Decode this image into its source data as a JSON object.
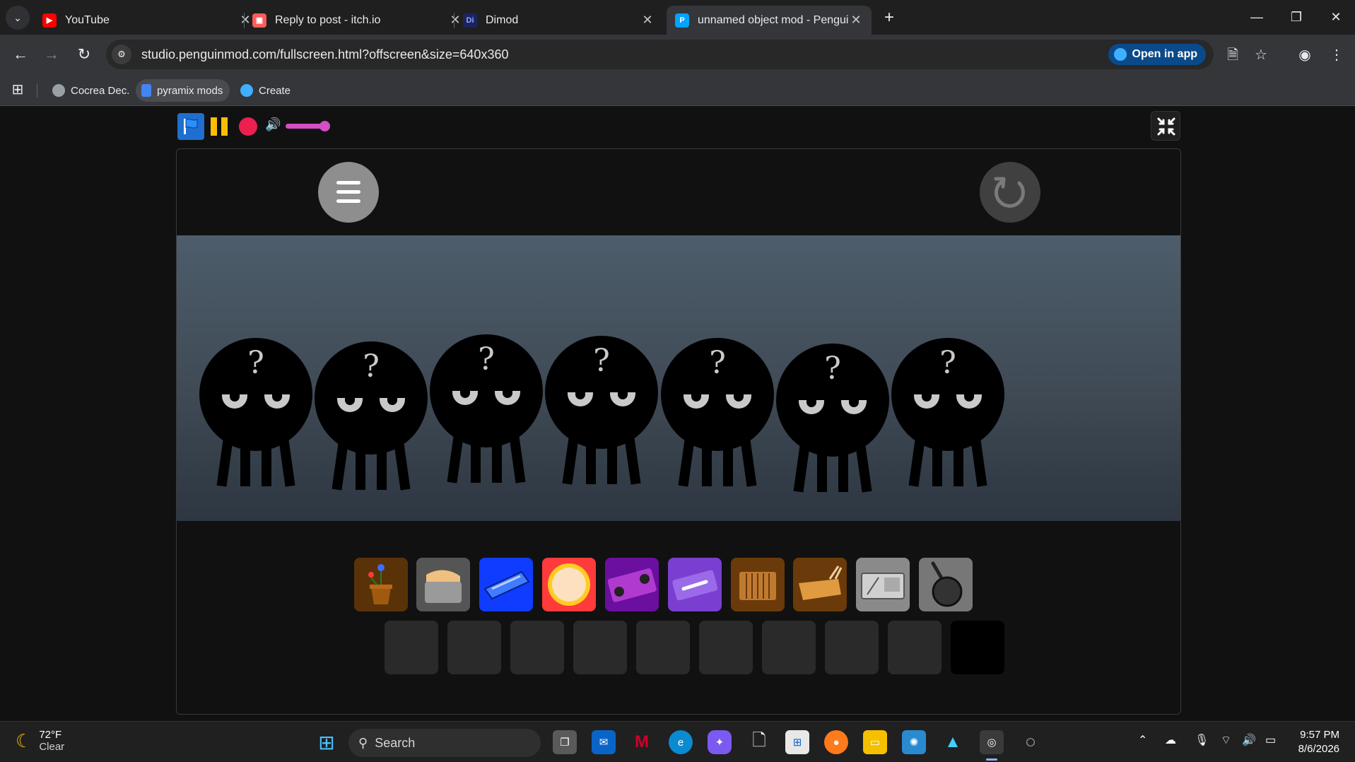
{
  "tabs": [
    {
      "title": "YouTube",
      "favicon": "youtube-icon",
      "color": "#ff0000",
      "active": false
    },
    {
      "title": "Reply to post - itch.io",
      "favicon": "itchio-icon",
      "color": "#fa5c5c",
      "active": false
    },
    {
      "title": "Dimod",
      "favicon": "dimod-icon",
      "color": "#2d3a8c",
      "active": false
    },
    {
      "title": "unnamed object mod - Penguir",
      "favicon": "penguinmod-icon",
      "color": "#00a3ff",
      "active": true
    }
  ],
  "toolbar": {
    "url": "studio.penguinmod.com/fullscreen.html?offscreen&size=640x360",
    "open_in_app": "Open in app"
  },
  "bookmarks": [
    {
      "label": "Cocrea Dec.",
      "icon": "globe-icon"
    },
    {
      "label": "pyramix mods",
      "icon": "doc-icon"
    },
    {
      "label": "Create",
      "icon": "penguinmod-icon"
    }
  ],
  "player": {
    "volume": 0.9
  },
  "scene": {
    "character_label": "?",
    "character_count": 7
  },
  "items": [
    {
      "name": "flower-pot-item",
      "bg": "#5a3208"
    },
    {
      "name": "toaster-item",
      "bg": "#555555"
    },
    {
      "name": "blue-keyboard-item",
      "bg": "#0f3cff"
    },
    {
      "name": "tambourine-item",
      "bg": "#ff3a3a"
    },
    {
      "name": "boombox-item",
      "bg": "#6a0fa0"
    },
    {
      "name": "cassette-item",
      "bg": "#7a3fd0"
    },
    {
      "name": "accordion-item",
      "bg": "#6a3a0a"
    },
    {
      "name": "xylophone-item",
      "bg": "#6a3a0a"
    },
    {
      "name": "keypad-item",
      "bg": "#8a8a8a"
    },
    {
      "name": "frying-pan-item",
      "bg": "#777777"
    }
  ],
  "taskbar": {
    "weather_temp": "72°F",
    "weather_desc": "Clear",
    "search_label": "Search",
    "time": "9:57 PM",
    "date": "8/6/2026"
  }
}
